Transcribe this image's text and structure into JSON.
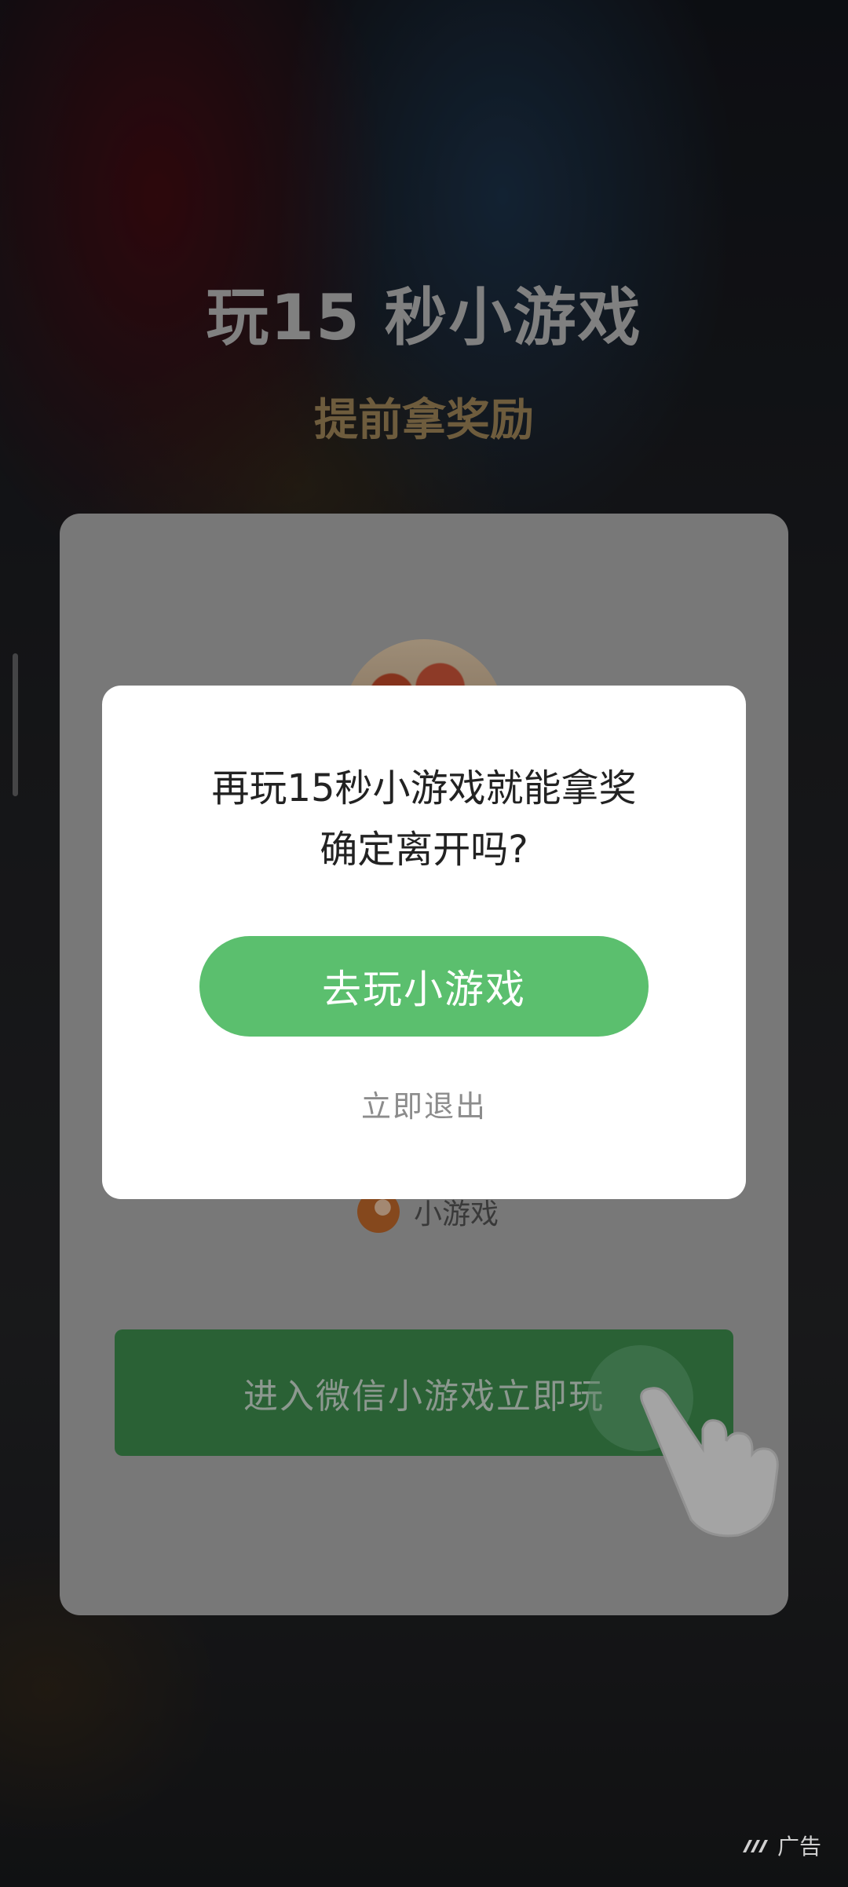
{
  "hero": {
    "title": "玩15 秒小游戏",
    "subtitle": "提前拿奖励"
  },
  "card": {
    "mini_program_label": "小游戏",
    "enter_button": "进入微信小游戏立即玩"
  },
  "dialog": {
    "line1": "再玩15秒小游戏就能拿奖",
    "line2": "确定离开吗?",
    "primary_button": "去玩小游戏",
    "secondary_button": "立即退出"
  },
  "ad_badge": {
    "label": "广告"
  },
  "colors": {
    "accent_green": "#5bbf6e",
    "card_button_green": "#3f8f4f",
    "subtitle_gold": "#a3885a"
  },
  "icons": [
    "scroll-indicator",
    "game-avatar",
    "mini-game-logo-icon",
    "hand-pointer-icon",
    "ad-logo-icon"
  ]
}
